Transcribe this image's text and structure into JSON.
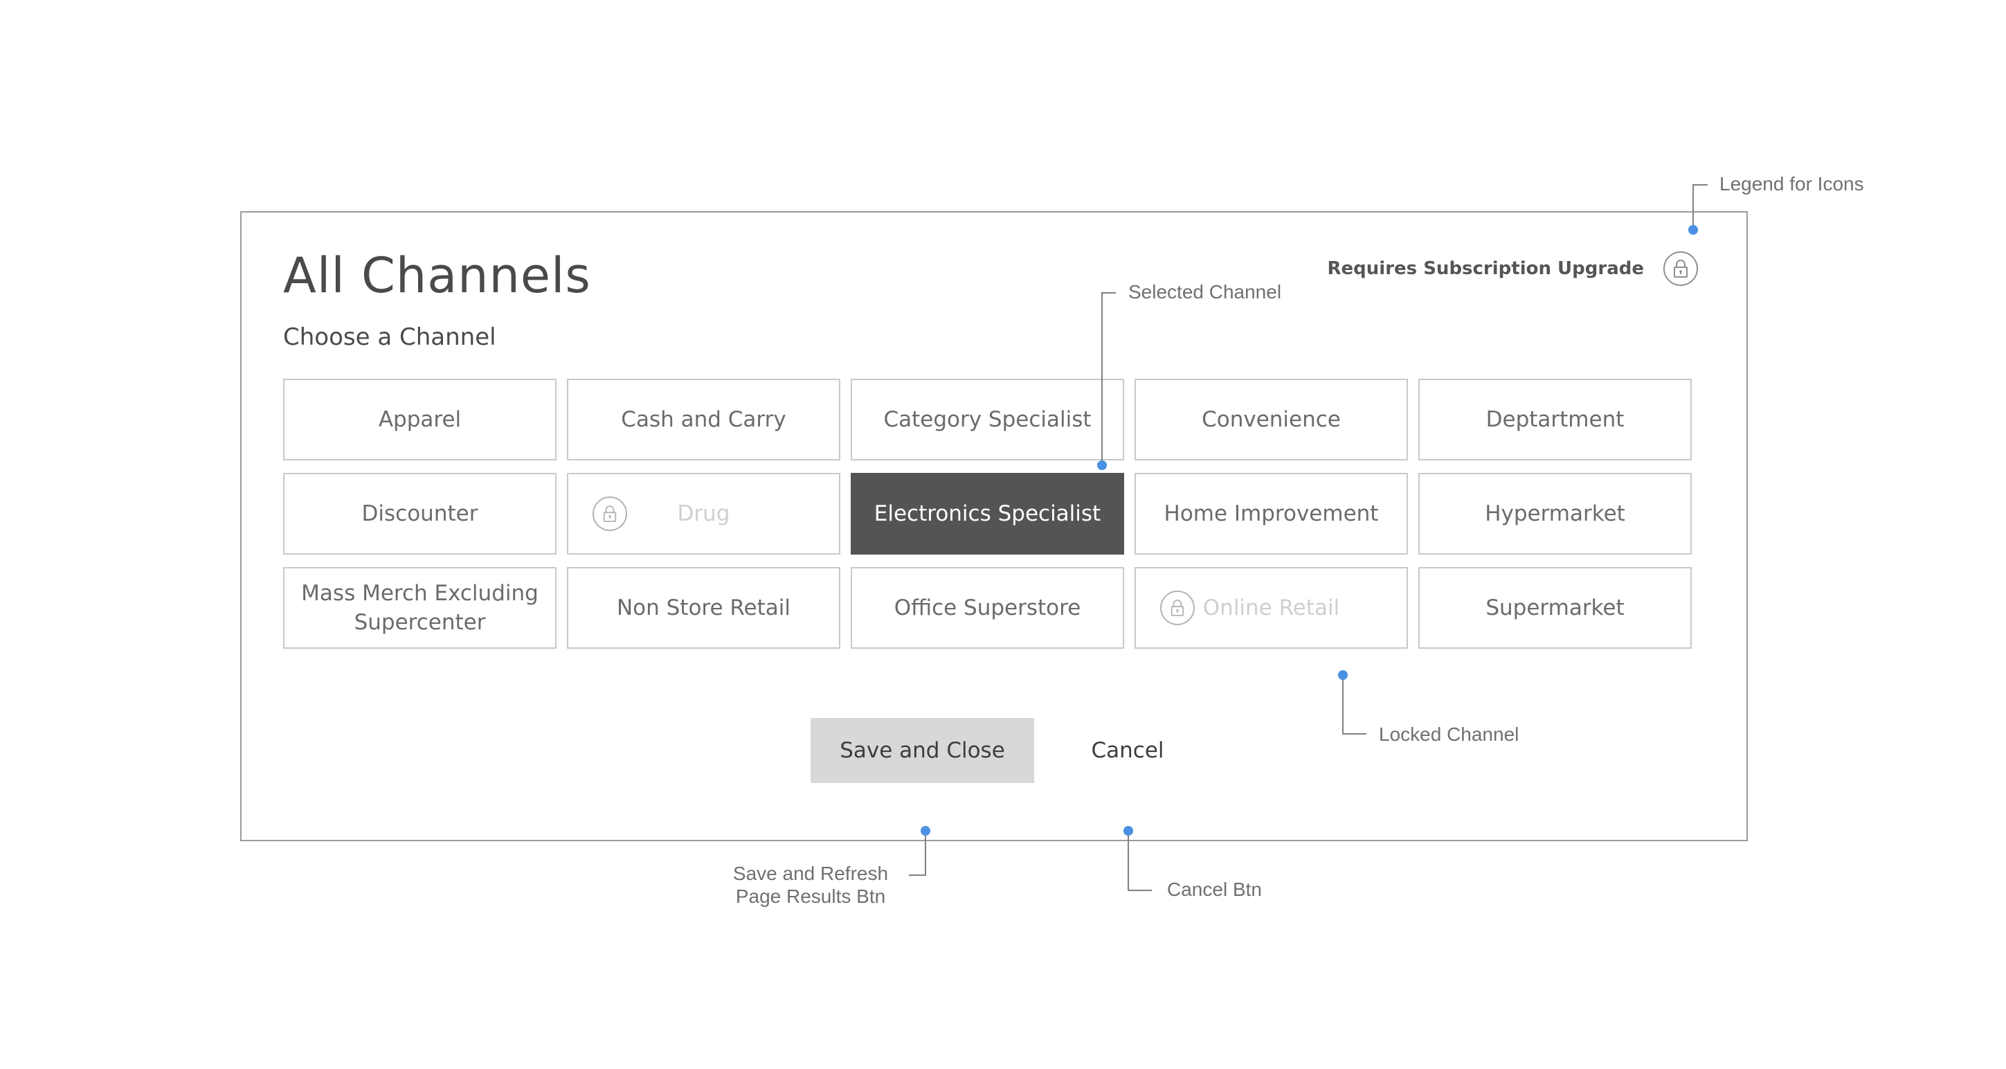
{
  "modal": {
    "title": "All Channels",
    "subtitle": "Choose a Channel",
    "legend_label": "Requires Subscription Upgrade",
    "legend_icon": "lock-icon"
  },
  "channels": [
    {
      "label": "Apparel",
      "state": "default"
    },
    {
      "label": "Cash and Carry",
      "state": "default"
    },
    {
      "label": "Category Specialist",
      "state": "default"
    },
    {
      "label": "Convenience",
      "state": "default"
    },
    {
      "label": "Deptartment",
      "state": "default"
    },
    {
      "label": "Discounter",
      "state": "default"
    },
    {
      "label": "Drug",
      "state": "locked"
    },
    {
      "label": "Electronics Specialist",
      "state": "selected"
    },
    {
      "label": "Home Improvement",
      "state": "default"
    },
    {
      "label": "Hypermarket",
      "state": "default"
    },
    {
      "label": "Mass Merch Excluding Supercenter",
      "state": "default"
    },
    {
      "label": "Non Store Retail",
      "state": "default"
    },
    {
      "label": "Office Superstore",
      "state": "default"
    },
    {
      "label": "Online Retail",
      "state": "locked"
    },
    {
      "label": "Supermarket",
      "state": "default"
    }
  ],
  "actions": {
    "save_label": "Save and Close",
    "cancel_label": "Cancel"
  },
  "annotations": {
    "legend": "Legend for Icons",
    "selected": "Selected Channel",
    "locked": "Locked Channel",
    "save_line1": "Save and Refresh",
    "save_line2": "Page Results Btn",
    "cancel": "Cancel Btn"
  },
  "colors": {
    "selected_bg": "#545454",
    "annotation_dot": "#4a90e2",
    "save_bg": "#d8d8d8"
  }
}
